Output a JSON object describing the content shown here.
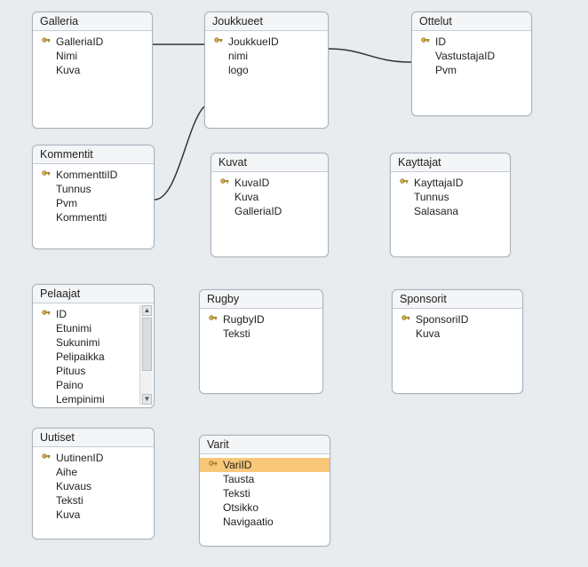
{
  "tables": {
    "galleria": {
      "title": "Galleria",
      "fields": [
        {
          "label": "GalleriaID",
          "pk": true
        },
        {
          "label": "Nimi",
          "pk": false
        },
        {
          "label": "Kuva",
          "pk": false
        }
      ]
    },
    "joukkueet": {
      "title": "Joukkueet",
      "fields": [
        {
          "label": "JoukkueID",
          "pk": true
        },
        {
          "label": "nimi",
          "pk": false
        },
        {
          "label": "logo",
          "pk": false
        }
      ]
    },
    "ottelut": {
      "title": "Ottelut",
      "fields": [
        {
          "label": "ID",
          "pk": true
        },
        {
          "label": "VastustajaID",
          "pk": false
        },
        {
          "label": "Pvm",
          "pk": false
        }
      ]
    },
    "kommentit": {
      "title": "Kommentit",
      "fields": [
        {
          "label": "KommenttiID",
          "pk": true
        },
        {
          "label": "Tunnus",
          "pk": false
        },
        {
          "label": "Pvm",
          "pk": false
        },
        {
          "label": "Kommentti",
          "pk": false
        }
      ]
    },
    "kuvat": {
      "title": "Kuvat",
      "fields": [
        {
          "label": "KuvaID",
          "pk": true
        },
        {
          "label": "Kuva",
          "pk": false
        },
        {
          "label": "GalleriaID",
          "pk": false
        }
      ]
    },
    "kayttajat": {
      "title": "Kayttajat",
      "fields": [
        {
          "label": "KayttajaID",
          "pk": true
        },
        {
          "label": "Tunnus",
          "pk": false
        },
        {
          "label": "Salasana",
          "pk": false
        }
      ]
    },
    "pelaajat": {
      "title": "Pelaajat",
      "fields": [
        {
          "label": "ID",
          "pk": true
        },
        {
          "label": "Etunimi",
          "pk": false
        },
        {
          "label": "Sukunimi",
          "pk": false
        },
        {
          "label": "Pelipaikka",
          "pk": false
        },
        {
          "label": "Pituus",
          "pk": false
        },
        {
          "label": "Paino",
          "pk": false
        },
        {
          "label": "Lempinimi",
          "pk": false
        }
      ]
    },
    "rugby": {
      "title": "Rugby",
      "fields": [
        {
          "label": "RugbyID",
          "pk": true
        },
        {
          "label": "Teksti",
          "pk": false
        }
      ]
    },
    "sponsorit": {
      "title": "Sponsorit",
      "fields": [
        {
          "label": "SponsoriID",
          "pk": true
        },
        {
          "label": "Kuva",
          "pk": false
        }
      ]
    },
    "uutiset": {
      "title": "Uutiset",
      "fields": [
        {
          "label": "UutinenID",
          "pk": true
        },
        {
          "label": "Aihe",
          "pk": false
        },
        {
          "label": "Kuvaus",
          "pk": false
        },
        {
          "label": "Teksti",
          "pk": false
        },
        {
          "label": "Kuva",
          "pk": false
        }
      ]
    },
    "varit": {
      "title": "Varit",
      "fields": [
        {
          "label": "VariID",
          "pk": true,
          "selected": true
        },
        {
          "label": "Tausta",
          "pk": false
        },
        {
          "label": "Teksti",
          "pk": false
        },
        {
          "label": "Otsikko",
          "pk": false
        },
        {
          "label": "Navigaatio",
          "pk": false
        }
      ]
    }
  }
}
